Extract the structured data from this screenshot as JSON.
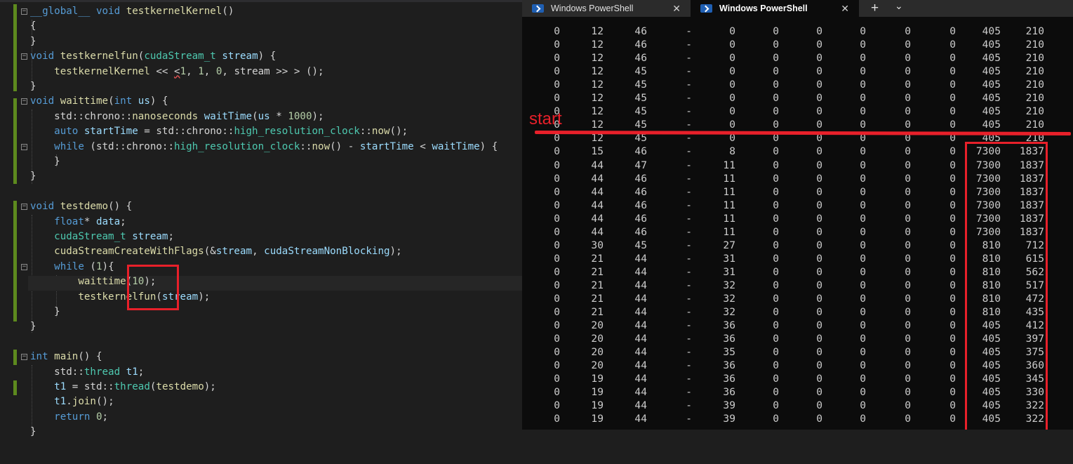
{
  "editor": {
    "lines": [
      [
        [
          "kw",
          "__global__"
        ],
        [
          "pl",
          " "
        ],
        [
          "kw",
          "void"
        ],
        [
          "pl",
          " "
        ],
        [
          "fn",
          "testkernelKernel"
        ],
        [
          "pl",
          "()"
        ]
      ],
      [
        [
          "pl",
          "{"
        ]
      ],
      [
        [
          "pl",
          "}"
        ]
      ],
      [
        [
          "kw",
          "void"
        ],
        [
          "pl",
          " "
        ],
        [
          "fn",
          "testkernelfun"
        ],
        [
          "pl",
          "("
        ],
        [
          "ty",
          "cudaStream_t"
        ],
        [
          "pl",
          " "
        ],
        [
          "pr",
          "stream"
        ],
        [
          "pl",
          ") {"
        ]
      ],
      [
        [
          "pl",
          "    "
        ],
        [
          "fn",
          "testkernelKernel"
        ],
        [
          "pl",
          " << "
        ],
        [
          "sq",
          "<"
        ],
        [
          "nm",
          "1"
        ],
        [
          "pl",
          ", "
        ],
        [
          "nm",
          "1"
        ],
        [
          "pl",
          ", "
        ],
        [
          "nm",
          "0"
        ],
        [
          "pl",
          ", stream >> > ();"
        ]
      ],
      [
        [
          "pl",
          "}"
        ]
      ],
      [
        [
          "kw",
          "void"
        ],
        [
          "pl",
          " "
        ],
        [
          "fn",
          "waittime"
        ],
        [
          "pl",
          "("
        ],
        [
          "kw",
          "int"
        ],
        [
          "pl",
          " "
        ],
        [
          "pr",
          "us"
        ],
        [
          "pl",
          ") {"
        ]
      ],
      [
        [
          "pl",
          "    std::chrono::"
        ],
        [
          "fn",
          "nanoseconds"
        ],
        [
          "pl",
          " "
        ],
        [
          "pr",
          "waitTime"
        ],
        [
          "pl",
          "("
        ],
        [
          "pr",
          "us"
        ],
        [
          "pl",
          " * "
        ],
        [
          "nm",
          "1000"
        ],
        [
          "pl",
          ");"
        ]
      ],
      [
        [
          "pl",
          "    "
        ],
        [
          "kw",
          "auto"
        ],
        [
          "pl",
          " "
        ],
        [
          "pr",
          "startTime"
        ],
        [
          "pl",
          " = std::chrono::"
        ],
        [
          "ty",
          "high_resolution_clock"
        ],
        [
          "pl",
          "::"
        ],
        [
          "fn",
          "now"
        ],
        [
          "pl",
          "();"
        ]
      ],
      [
        [
          "pl",
          "    "
        ],
        [
          "kw",
          "while"
        ],
        [
          "pl",
          " (std::chrono::"
        ],
        [
          "ty",
          "high_resolution_clock"
        ],
        [
          "pl",
          "::"
        ],
        [
          "fn",
          "now"
        ],
        [
          "pl",
          "() - "
        ],
        [
          "pr",
          "startTime"
        ],
        [
          "pl",
          " < "
        ],
        [
          "pr",
          "waitTime"
        ],
        [
          "pl",
          ") {"
        ]
      ],
      [
        [
          "pl",
          "    }"
        ]
      ],
      [
        [
          "pl",
          "}"
        ]
      ],
      [
        [
          "pl",
          ""
        ]
      ],
      [
        [
          "kw",
          "void"
        ],
        [
          "pl",
          " "
        ],
        [
          "fn",
          "testdemo"
        ],
        [
          "pl",
          "() {"
        ]
      ],
      [
        [
          "pl",
          "    "
        ],
        [
          "kw",
          "float"
        ],
        [
          "pl",
          "* "
        ],
        [
          "pr",
          "data"
        ],
        [
          "pl",
          ";"
        ]
      ],
      [
        [
          "pl",
          "    "
        ],
        [
          "ty",
          "cudaStream_t"
        ],
        [
          "pl",
          " "
        ],
        [
          "pr",
          "stream"
        ],
        [
          "pl",
          ";"
        ]
      ],
      [
        [
          "pl",
          "    "
        ],
        [
          "fn",
          "cudaStreamCreateWithFlags"
        ],
        [
          "pl",
          "(&"
        ],
        [
          "pr",
          "stream"
        ],
        [
          "pl",
          ", "
        ],
        [
          "pr",
          "cudaStreamNonBlocking"
        ],
        [
          "pl",
          ");"
        ]
      ],
      [
        [
          "pl",
          "    "
        ],
        [
          "kw",
          "while"
        ],
        [
          "pl",
          " ("
        ],
        [
          "nm",
          "1"
        ],
        [
          "pl",
          "){"
        ]
      ],
      [
        [
          "pl",
          "        "
        ],
        [
          "fn",
          "waittime"
        ],
        [
          "pl",
          "("
        ],
        [
          "nm",
          "10"
        ],
        [
          "pl",
          ");"
        ]
      ],
      [
        [
          "pl",
          "        "
        ],
        [
          "fn",
          "testkernelfun"
        ],
        [
          "pl",
          "("
        ],
        [
          "pr",
          "stream"
        ],
        [
          "pl",
          ");"
        ]
      ],
      [
        [
          "pl",
          "    }"
        ]
      ],
      [
        [
          "pl",
          "}"
        ]
      ],
      [
        [
          "pl",
          ""
        ]
      ],
      [
        [
          "kw",
          "int"
        ],
        [
          "pl",
          " "
        ],
        [
          "fn",
          "main"
        ],
        [
          "pl",
          "() {"
        ]
      ],
      [
        [
          "pl",
          "    std::"
        ],
        [
          "ty",
          "thread"
        ],
        [
          "pl",
          " "
        ],
        [
          "pr",
          "t1"
        ],
        [
          "pl",
          ";"
        ]
      ],
      [
        [
          "pl",
          "    "
        ],
        [
          "pr",
          "t1"
        ],
        [
          "pl",
          " = std::"
        ],
        [
          "ty",
          "thread"
        ],
        [
          "pl",
          "("
        ],
        [
          "fn",
          "testdemo"
        ],
        [
          "pl",
          ");"
        ]
      ],
      [
        [
          "pl",
          "    "
        ],
        [
          "pr",
          "t1"
        ],
        [
          "pl",
          "."
        ],
        [
          "fn",
          "join"
        ],
        [
          "pl",
          "();"
        ]
      ],
      [
        [
          "pl",
          "    "
        ],
        [
          "kw",
          "return"
        ],
        [
          "pl",
          " "
        ],
        [
          "nm",
          "0"
        ],
        [
          "pl",
          ";"
        ]
      ],
      [
        [
          "pl",
          "}"
        ]
      ]
    ]
  },
  "terminal": {
    "tabs": [
      {
        "label": "Windows PowerShell",
        "active": false
      },
      {
        "label": "Windows PowerShell",
        "active": true
      }
    ],
    "new_tab_glyph": "+",
    "dropdown_glyph": "⌄",
    "close_glyph": "✕",
    "annotation_label": "start",
    "rows": [
      [
        "0",
        "12",
        "46",
        "-",
        "0",
        "0",
        "0",
        "0",
        "0",
        "0",
        "405",
        "210"
      ],
      [
        "0",
        "12",
        "46",
        "-",
        "0",
        "0",
        "0",
        "0",
        "0",
        "0",
        "405",
        "210"
      ],
      [
        "0",
        "12",
        "46",
        "-",
        "0",
        "0",
        "0",
        "0",
        "0",
        "0",
        "405",
        "210"
      ],
      [
        "0",
        "12",
        "45",
        "-",
        "0",
        "0",
        "0",
        "0",
        "0",
        "0",
        "405",
        "210"
      ],
      [
        "0",
        "12",
        "45",
        "-",
        "0",
        "0",
        "0",
        "0",
        "0",
        "0",
        "405",
        "210"
      ],
      [
        "0",
        "12",
        "45",
        "-",
        "0",
        "0",
        "0",
        "0",
        "0",
        "0",
        "405",
        "210"
      ],
      [
        "0",
        "12",
        "45",
        "-",
        "0",
        "0",
        "0",
        "0",
        "0",
        "0",
        "405",
        "210"
      ],
      [
        "0",
        "12",
        "45",
        "-",
        "0",
        "0",
        "0",
        "0",
        "0",
        "0",
        "405",
        "210"
      ],
      [
        "0",
        "12",
        "45",
        "-",
        "0",
        "0",
        "0",
        "0",
        "0",
        "0",
        "405",
        "210"
      ],
      [
        "0",
        "15",
        "46",
        "-",
        "8",
        "0",
        "0",
        "0",
        "0",
        "0",
        "7300",
        "1837"
      ],
      [
        "0",
        "44",
        "47",
        "-",
        "11",
        "0",
        "0",
        "0",
        "0",
        "0",
        "7300",
        "1837"
      ],
      [
        "0",
        "44",
        "46",
        "-",
        "11",
        "0",
        "0",
        "0",
        "0",
        "0",
        "7300",
        "1837"
      ],
      [
        "0",
        "44",
        "46",
        "-",
        "11",
        "0",
        "0",
        "0",
        "0",
        "0",
        "7300",
        "1837"
      ],
      [
        "0",
        "44",
        "46",
        "-",
        "11",
        "0",
        "0",
        "0",
        "0",
        "0",
        "7300",
        "1837"
      ],
      [
        "0",
        "44",
        "46",
        "-",
        "11",
        "0",
        "0",
        "0",
        "0",
        "0",
        "7300",
        "1837"
      ],
      [
        "0",
        "44",
        "46",
        "-",
        "11",
        "0",
        "0",
        "0",
        "0",
        "0",
        "7300",
        "1837"
      ],
      [
        "0",
        "30",
        "45",
        "-",
        "27",
        "0",
        "0",
        "0",
        "0",
        "0",
        "810",
        "712"
      ],
      [
        "0",
        "21",
        "44",
        "-",
        "31",
        "0",
        "0",
        "0",
        "0",
        "0",
        "810",
        "615"
      ],
      [
        "0",
        "21",
        "44",
        "-",
        "31",
        "0",
        "0",
        "0",
        "0",
        "0",
        "810",
        "562"
      ],
      [
        "0",
        "21",
        "44",
        "-",
        "32",
        "0",
        "0",
        "0",
        "0",
        "0",
        "810",
        "517"
      ],
      [
        "0",
        "21",
        "44",
        "-",
        "32",
        "0",
        "0",
        "0",
        "0",
        "0",
        "810",
        "472"
      ],
      [
        "0",
        "21",
        "44",
        "-",
        "32",
        "0",
        "0",
        "0",
        "0",
        "0",
        "810",
        "435"
      ],
      [
        "0",
        "20",
        "44",
        "-",
        "36",
        "0",
        "0",
        "0",
        "0",
        "0",
        "405",
        "412"
      ],
      [
        "0",
        "20",
        "44",
        "-",
        "36",
        "0",
        "0",
        "0",
        "0",
        "0",
        "405",
        "397"
      ],
      [
        "0",
        "20",
        "44",
        "-",
        "35",
        "0",
        "0",
        "0",
        "0",
        "0",
        "405",
        "375"
      ],
      [
        "0",
        "20",
        "44",
        "-",
        "36",
        "0",
        "0",
        "0",
        "0",
        "0",
        "405",
        "360"
      ],
      [
        "0",
        "19",
        "44",
        "-",
        "36",
        "0",
        "0",
        "0",
        "0",
        "0",
        "405",
        "345"
      ],
      [
        "0",
        "19",
        "44",
        "-",
        "36",
        "0",
        "0",
        "0",
        "0",
        "0",
        "405",
        "330"
      ],
      [
        "0",
        "19",
        "44",
        "-",
        "39",
        "0",
        "0",
        "0",
        "0",
        "0",
        "405",
        "322"
      ],
      [
        "0",
        "19",
        "44",
        "-",
        "39",
        "0",
        "0",
        "0",
        "0",
        "0",
        "405",
        "322"
      ]
    ]
  },
  "colors": {
    "annotation_red": "#e8202a",
    "gutter_change": "#5d8a1e",
    "powershell_blue": "#1f5fb3"
  }
}
